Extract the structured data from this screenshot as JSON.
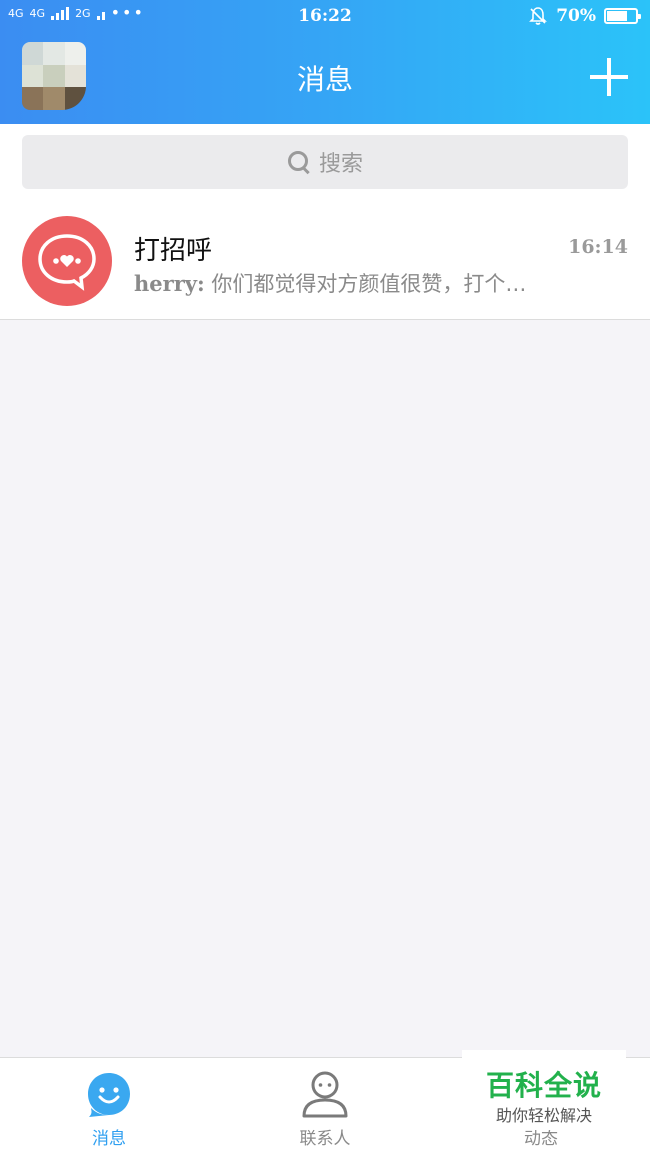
{
  "status_bar": {
    "network_1": "4G",
    "network_2": "4G",
    "network_3": "2G",
    "time": "16:22",
    "battery": "70%",
    "battery_level": 0.7
  },
  "header": {
    "title": "消息"
  },
  "search": {
    "placeholder": "搜索"
  },
  "conversations": [
    {
      "name": "打招呼",
      "time": "16:14",
      "sender": "herry:",
      "message": "你们都觉得对方颜值很赞，打个…",
      "avatar_color": "#ec5f61"
    }
  ],
  "tabs": [
    {
      "label": "消息",
      "icon": "message-bubble-icon",
      "active": true
    },
    {
      "label": "联系人",
      "icon": "contact-person-icon",
      "active": false
    },
    {
      "label": "动态",
      "icon": "star-icon",
      "active": false
    }
  ],
  "watermark": {
    "title": "百科全说",
    "subtitle": "助你轻松解决"
  },
  "colors": {
    "header_start": "#3b8df2",
    "header_end": "#2bc3f9",
    "accent": "#2f9ff0",
    "background": "#f5f4f8"
  }
}
